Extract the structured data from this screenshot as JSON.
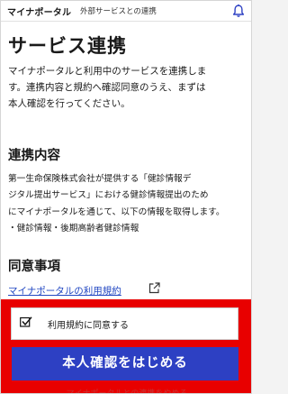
{
  "header": {
    "brand": "マイナポータル",
    "subtitle": "外部サービスとの連携",
    "icon": "bell-icon"
  },
  "page": {
    "title": "サービス連携",
    "intro_lines": [
      "マイナポータルと利用中のサービスを連携しま",
      "す。連携内容と規約へ確認同意のうえ、まずは",
      "本人確認を行ってください。"
    ]
  },
  "section_linkage": {
    "heading": "連携内容",
    "lines": [
      "第一生命保険株式会社が提供する「健診情報デ",
      "ジタル提出サービス」における健診情報提出のため",
      "にマイナポータルを通じて、以下の情報を取得します。",
      "・健診情報・後期高齢者健診情報"
    ]
  },
  "section_consent": {
    "heading": "同意事項",
    "terms_link": "マイナポータルの利用規約",
    "link_icon": "external-link-icon"
  },
  "footer": {
    "consent_label": "利用規約に同意する",
    "consent_checked": true,
    "primary_button": "本人確認をはじめる",
    "secondary_text": "マイナポータルとの連携をやめる",
    "highlight_color": "#e80000",
    "button_color": "#2d40c3"
  }
}
